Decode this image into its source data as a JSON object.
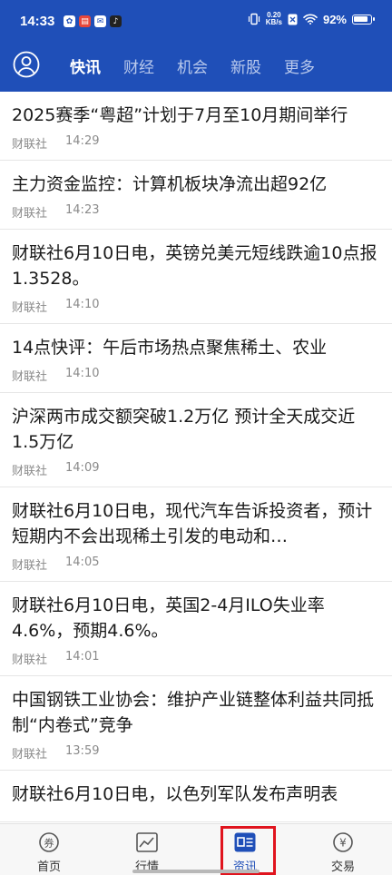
{
  "status_bar": {
    "time": "14:33",
    "speed_value": "0.20",
    "speed_unit": "KB/s",
    "battery": "92%"
  },
  "nav": {
    "tabs": [
      {
        "label": "快讯",
        "active": true
      },
      {
        "label": "财经",
        "active": false
      },
      {
        "label": "机会",
        "active": false
      },
      {
        "label": "新股",
        "active": false
      },
      {
        "label": "更多",
        "active": false
      }
    ]
  },
  "news": [
    {
      "title": "2025赛季“粤超”计划于7月至10月期间举行",
      "source": "财联社",
      "time": "14:29"
    },
    {
      "title": "主力资金监控：计算机板块净流出超92亿",
      "source": "财联社",
      "time": "14:23"
    },
    {
      "title": "财联社6月10日电，英镑兑美元短线跌逾10点报1.3528。",
      "source": "财联社",
      "time": "14:10"
    },
    {
      "title": "14点快评：午后市场热点聚焦稀土、农业",
      "source": "财联社",
      "time": "14:10"
    },
    {
      "title": "沪深两市成交额突破1.2万亿 预计全天成交近1.5万亿",
      "source": "财联社",
      "time": "14:09"
    },
    {
      "title": "财联社6月10日电，现代汽车告诉投资者，预计短期内不会出现稀土引发的电动和…",
      "source": "财联社",
      "time": "14:05"
    },
    {
      "title": "财联社6月10日电，英国2-4月ILO失业率4.6%，预期4.6%。",
      "source": "财联社",
      "time": "14:01"
    },
    {
      "title": "中国钢铁工业协会：维护产业链整体利益共同抵制“内卷式”竞争",
      "source": "财联社",
      "time": "13:59"
    },
    {
      "title": "财联社6月10日电，以色列军队发布声明表",
      "source": "",
      "time": ""
    }
  ],
  "bottom_nav": [
    {
      "label": "首页",
      "icon": "home-coin-icon"
    },
    {
      "label": "行情",
      "icon": "market-chart-icon"
    },
    {
      "label": "资讯",
      "icon": "news-icon",
      "active": true
    },
    {
      "label": "交易",
      "icon": "trade-yen-icon"
    }
  ],
  "colors": {
    "header": "#1f4fb8",
    "active_tab": "#ffffff",
    "inactive_tab": "#b9c9ec",
    "highlight": "#e0141e"
  }
}
